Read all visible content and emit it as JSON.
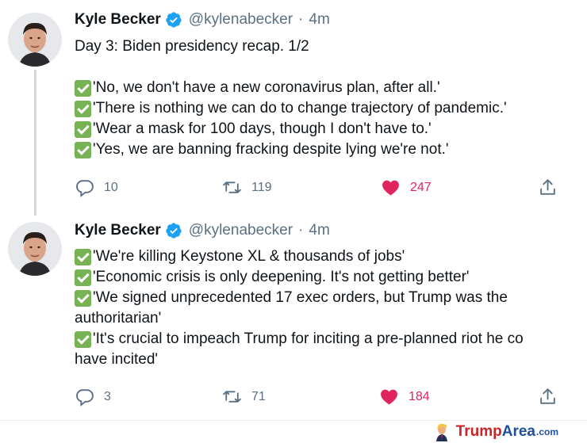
{
  "tweets": [
    {
      "author_name": "Kyle Becker",
      "handle": "@kylenabecker",
      "separator": "·",
      "time": "4m",
      "lines": [
        {
          "check": false,
          "text": "Day 3: Biden presidency recap. 1/2"
        },
        {
          "check": false,
          "text": ""
        },
        {
          "check": true,
          "text": "'No, we don't have a new coronavirus plan, after all.'"
        },
        {
          "check": true,
          "text": "'There is nothing we can do to change trajectory of pandemic.'"
        },
        {
          "check": true,
          "text": "'Wear a mask for 100 days, though I don't have to.'"
        },
        {
          "check": true,
          "text": "'Yes, we are banning fracking despite lying we're not.'"
        }
      ],
      "replies": "10",
      "retweets": "119",
      "likes": "247"
    },
    {
      "author_name": "Kyle Becker",
      "handle": "@kylenabecker",
      "separator": "·",
      "time": "4m",
      "lines": [
        {
          "check": true,
          "text": "'We're killing Keystone XL & thousands of jobs'"
        },
        {
          "check": true,
          "text": "'Economic crisis is only deepening. It's not getting better'"
        },
        {
          "check": true,
          "text": "'We signed unprecedented 17 exec orders, but Trump was the"
        },
        {
          "check": false,
          "text": "authoritarian'"
        },
        {
          "check": true,
          "text": "'It's crucial to impeach Trump for inciting a pre-planned riot he co"
        },
        {
          "check": false,
          "text": "have incited'"
        }
      ],
      "replies": "3",
      "retweets": "71",
      "likes": "184"
    }
  ],
  "icons": {
    "verified": "verified-badge-icon",
    "reply": "reply-icon",
    "retweet": "retweet-icon",
    "like": "heart-icon",
    "share": "share-icon",
    "check": "check-mark-icon"
  },
  "colors": {
    "verified": "#1da1f2",
    "like": "#e0245e",
    "muted": "#5b7083",
    "check": "#77b255"
  },
  "watermark": {
    "part1": "Trump",
    "part2": "Area",
    "suffix": ".com"
  }
}
